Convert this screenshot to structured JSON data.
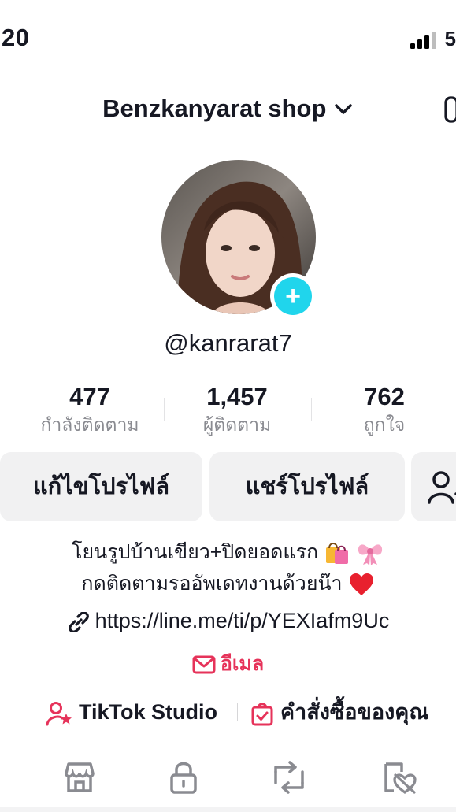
{
  "status_bar": {
    "time": "20",
    "battery_peek": "5"
  },
  "header": {
    "title": "Benzkanyarat shop"
  },
  "profile": {
    "username": "@kanrarat7"
  },
  "stats": [
    {
      "value": "477",
      "label": "กำลังติดตาม"
    },
    {
      "value": "1,457",
      "label": "ผู้ติดตาม"
    },
    {
      "value": "762",
      "label": "ถูกใจ"
    }
  ],
  "actions": {
    "edit_profile": "แก้ไขโปรไฟล์",
    "share_profile": "แชร์โปรไฟล์"
  },
  "bio": {
    "line1": "โยนรูปบ้านเขียว+ปิดยอดแรก",
    "line2": "กดติดตามรออัพเดทงานด้วยน๊า"
  },
  "link": {
    "url": "https://line.me/ti/p/YEXIafm9Uc"
  },
  "email": {
    "label": "อีเมล"
  },
  "shortcuts": {
    "studio": "TikTok Studio",
    "orders": "คำสั่งซื้อของคุณ"
  },
  "tabs": [
    "shop-icon",
    "lock-icon",
    "repost-icon",
    "liked-hidden-icon"
  ],
  "colors": {
    "accent_pink": "#e6335a",
    "badge_cyan": "#20d5ec",
    "text": "#161823",
    "muted": "#8a8b91"
  }
}
